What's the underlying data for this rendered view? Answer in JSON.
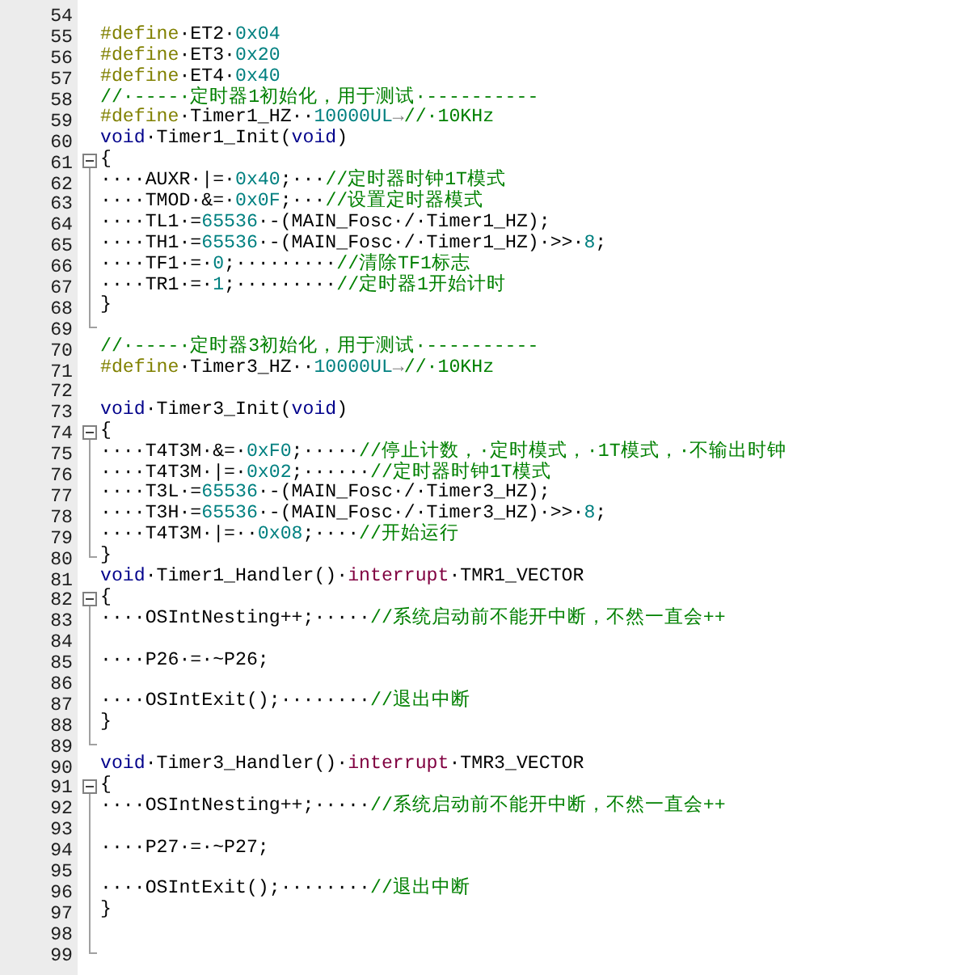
{
  "editor": {
    "lines": [
      {
        "number": "54",
        "kind": "plain"
      },
      {
        "number": "55",
        "tokens": [
          {
            "kind": "directive",
            "text": "#define"
          },
          {
            "kind": "plain",
            "text": "·ET2·"
          },
          {
            "kind": "number",
            "text": "0x04"
          }
        ]
      },
      {
        "number": "56",
        "tokens": [
          {
            "kind": "directive",
            "text": "#define"
          },
          {
            "kind": "plain",
            "text": "·ET3·"
          },
          {
            "kind": "number",
            "text": "0x20"
          }
        ]
      },
      {
        "number": "57",
        "tokens": [
          {
            "kind": "directive",
            "text": "#define"
          },
          {
            "kind": "plain",
            "text": "·ET4·"
          },
          {
            "kind": "number",
            "text": "0x40"
          }
        ]
      },
      {
        "number": "58",
        "tokens": [
          {
            "kind": "comment",
            "text": "//·----·定时器1初始化，用于测试·----------"
          }
        ]
      },
      {
        "number": "59",
        "tokens": [
          {
            "kind": "directive",
            "text": "#define"
          },
          {
            "kind": "plain",
            "text": "·Timer1_HZ··"
          },
          {
            "kind": "number",
            "text": "10000UL"
          },
          {
            "kind": "tab",
            "text": "→"
          },
          {
            "kind": "comment",
            "text": "//·10KHz"
          }
        ]
      },
      {
        "number": "60",
        "tokens": [
          {
            "kind": "keyword",
            "text": "void"
          },
          {
            "kind": "plain",
            "text": "·Timer1_Init("
          },
          {
            "kind": "keyword",
            "text": "void"
          },
          {
            "kind": "plain",
            "text": ")"
          }
        ]
      },
      {
        "number": "61",
        "kind": "foldstart",
        "tokens": [
          {
            "kind": "plain",
            "text": "{"
          }
        ]
      },
      {
        "number": "62",
        "kind": "foldbody",
        "tokens": [
          {
            "kind": "plain",
            "text": "····AUXR·|=·"
          },
          {
            "kind": "number",
            "text": "0x40"
          },
          {
            "kind": "plain",
            "text": ";···"
          },
          {
            "kind": "comment",
            "text": "//定时器时钟1T模式"
          }
        ]
      },
      {
        "number": "63",
        "kind": "foldbody",
        "tokens": [
          {
            "kind": "plain",
            "text": "····TMOD·&=·"
          },
          {
            "kind": "number",
            "text": "0x0F"
          },
          {
            "kind": "plain",
            "text": ";···"
          },
          {
            "kind": "comment",
            "text": "//设置定时器模式"
          }
        ]
      },
      {
        "number": "64",
        "kind": "foldbody",
        "tokens": [
          {
            "kind": "plain",
            "text": "····TL1·="
          },
          {
            "kind": "number",
            "text": "65536"
          },
          {
            "kind": "plain",
            "text": "·-(MAIN_Fosc·/·Timer1_HZ);"
          }
        ]
      },
      {
        "number": "65",
        "kind": "foldbody",
        "tokens": [
          {
            "kind": "plain",
            "text": "····TH1·="
          },
          {
            "kind": "number",
            "text": "65536"
          },
          {
            "kind": "plain",
            "text": "·-(MAIN_Fosc·/·Timer1_HZ)·>>·"
          },
          {
            "kind": "number",
            "text": "8"
          },
          {
            "kind": "plain",
            "text": ";"
          }
        ]
      },
      {
        "number": "66",
        "kind": "foldbody",
        "tokens": [
          {
            "kind": "plain",
            "text": "····TF1·=·"
          },
          {
            "kind": "number",
            "text": "0"
          },
          {
            "kind": "plain",
            "text": ";·········"
          },
          {
            "kind": "comment",
            "text": "//清除TF1标志"
          }
        ]
      },
      {
        "number": "67",
        "kind": "foldbody",
        "tokens": [
          {
            "kind": "plain",
            "text": "····TR1·=·"
          },
          {
            "kind": "number",
            "text": "1"
          },
          {
            "kind": "plain",
            "text": ";·········"
          },
          {
            "kind": "comment",
            "text": "//定时器1开始计时"
          }
        ]
      },
      {
        "number": "68",
        "kind": "foldbody",
        "tokens": [
          {
            "kind": "plain",
            "text": "}"
          }
        ]
      },
      {
        "number": "69",
        "kind": "foldend"
      },
      {
        "number": "70",
        "tokens": [
          {
            "kind": "comment",
            "text": "//·----·定时器3初始化，用于测试·----------"
          }
        ]
      },
      {
        "number": "71",
        "tokens": [
          {
            "kind": "directive",
            "text": "#define"
          },
          {
            "kind": "plain",
            "text": "·Timer3_HZ··"
          },
          {
            "kind": "number",
            "text": "10000UL"
          },
          {
            "kind": "tab",
            "text": "→"
          },
          {
            "kind": "comment",
            "text": "//·10KHz"
          }
        ]
      },
      {
        "number": "72",
        "kind": "plain"
      },
      {
        "number": "73",
        "tokens": [
          {
            "kind": "keyword",
            "text": "void"
          },
          {
            "kind": "plain",
            "text": "·Timer3_Init("
          },
          {
            "kind": "keyword",
            "text": "void"
          },
          {
            "kind": "plain",
            "text": ")"
          }
        ]
      },
      {
        "number": "74",
        "kind": "foldstart",
        "tokens": [
          {
            "kind": "plain",
            "text": "{"
          }
        ]
      },
      {
        "number": "75",
        "kind": "foldbody",
        "tokens": [
          {
            "kind": "plain",
            "text": "····T4T3M·&=·"
          },
          {
            "kind": "number",
            "text": "0xF0"
          },
          {
            "kind": "plain",
            "text": ";·····"
          },
          {
            "kind": "comment",
            "text": "//停止计数，·定时模式，·1T模式，·不输出时钟"
          }
        ]
      },
      {
        "number": "76",
        "kind": "foldbody",
        "tokens": [
          {
            "kind": "plain",
            "text": "····T4T3M·|=·"
          },
          {
            "kind": "number",
            "text": "0x02"
          },
          {
            "kind": "plain",
            "text": ";······"
          },
          {
            "kind": "comment",
            "text": "//定时器时钟1T模式"
          }
        ]
      },
      {
        "number": "77",
        "kind": "foldbody",
        "tokens": [
          {
            "kind": "plain",
            "text": "····T3L·="
          },
          {
            "kind": "number",
            "text": "65536"
          },
          {
            "kind": "plain",
            "text": "·-(MAIN_Fosc·/·Timer3_HZ);"
          }
        ]
      },
      {
        "number": "78",
        "kind": "foldbody",
        "tokens": [
          {
            "kind": "plain",
            "text": "····T3H·="
          },
          {
            "kind": "number",
            "text": "65536"
          },
          {
            "kind": "plain",
            "text": "·-(MAIN_Fosc·/·Timer3_HZ)·>>·"
          },
          {
            "kind": "number",
            "text": "8"
          },
          {
            "kind": "plain",
            "text": ";"
          }
        ]
      },
      {
        "number": "79",
        "kind": "foldbody",
        "tokens": [
          {
            "kind": "plain",
            "text": "····T4T3M·|=··"
          },
          {
            "kind": "number",
            "text": "0x08"
          },
          {
            "kind": "plain",
            "text": ";····"
          },
          {
            "kind": "comment",
            "text": "//开始运行"
          }
        ]
      },
      {
        "number": "80",
        "kind": "foldend",
        "tokens": [
          {
            "kind": "plain",
            "text": "}"
          }
        ]
      },
      {
        "number": "81",
        "tokens": [
          {
            "kind": "keyword",
            "text": "void"
          },
          {
            "kind": "plain",
            "text": "·Timer1_Handler()·"
          },
          {
            "kind": "qualifier",
            "text": "interrupt"
          },
          {
            "kind": "plain",
            "text": "·TMR1_VECTOR"
          }
        ]
      },
      {
        "number": "82",
        "kind": "foldstart",
        "tokens": [
          {
            "kind": "plain",
            "text": "{"
          }
        ]
      },
      {
        "number": "83",
        "kind": "foldbody",
        "tokens": [
          {
            "kind": "plain",
            "text": "····OSIntNesting++;·····"
          },
          {
            "kind": "comment",
            "text": "//系统启动前不能开中断，不然一直会++"
          }
        ]
      },
      {
        "number": "84",
        "kind": "foldbody"
      },
      {
        "number": "85",
        "kind": "foldbody",
        "tokens": [
          {
            "kind": "plain",
            "text": "····P26·=·~P26;"
          }
        ]
      },
      {
        "number": "86",
        "kind": "foldbody"
      },
      {
        "number": "87",
        "kind": "foldbody",
        "tokens": [
          {
            "kind": "plain",
            "text": "····OSIntExit();········"
          },
          {
            "kind": "comment",
            "text": "//退出中断"
          }
        ]
      },
      {
        "number": "88",
        "kind": "foldbody",
        "tokens": [
          {
            "kind": "plain",
            "text": "}"
          }
        ]
      },
      {
        "number": "89",
        "kind": "foldend"
      },
      {
        "number": "90",
        "tokens": [
          {
            "kind": "keyword",
            "text": "void"
          },
          {
            "kind": "plain",
            "text": "·Timer3_Handler()·"
          },
          {
            "kind": "qualifier",
            "text": "interrupt"
          },
          {
            "kind": "plain",
            "text": "·TMR3_VECTOR"
          }
        ]
      },
      {
        "number": "91",
        "kind": "foldstart",
        "tokens": [
          {
            "kind": "plain",
            "text": "{"
          }
        ]
      },
      {
        "number": "92",
        "kind": "foldbody",
        "tokens": [
          {
            "kind": "plain",
            "text": "····OSIntNesting++;·····"
          },
          {
            "kind": "comment",
            "text": "//系统启动前不能开中断，不然一直会++"
          }
        ]
      },
      {
        "number": "93",
        "kind": "foldbody"
      },
      {
        "number": "94",
        "kind": "foldbody",
        "tokens": [
          {
            "kind": "plain",
            "text": "····P27·=·~P27;"
          }
        ]
      },
      {
        "number": "95",
        "kind": "foldbody"
      },
      {
        "number": "96",
        "kind": "foldbody",
        "tokens": [
          {
            "kind": "plain",
            "text": "····OSIntExit();········"
          },
          {
            "kind": "comment",
            "text": "//退出中断"
          }
        ]
      },
      {
        "number": "97",
        "kind": "foldbody",
        "tokens": [
          {
            "kind": "plain",
            "text": "}"
          }
        ]
      },
      {
        "number": "98",
        "kind": "foldbody"
      },
      {
        "number": "99",
        "kind": "foldend"
      }
    ]
  }
}
